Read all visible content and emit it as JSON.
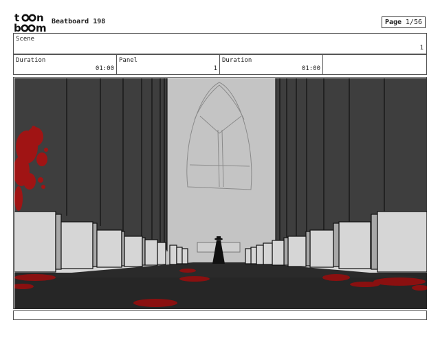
{
  "header": {
    "logo_line1": "toon",
    "logo_line2": "boom",
    "title": "Beatboard 198",
    "page_label": "Page",
    "page_value": "1/56"
  },
  "scene": {
    "label": "Scene",
    "value": "1"
  },
  "panel_info": {
    "duration1_label": "Duration",
    "duration1_value": "01:00",
    "panel_label": "Panel",
    "panel_value": "1",
    "duration2_label": "Duration",
    "duration2_value": "01:00"
  },
  "colors": {
    "blood": "#a01414",
    "floor": "#262626",
    "wall": "#3c3c3c"
  }
}
